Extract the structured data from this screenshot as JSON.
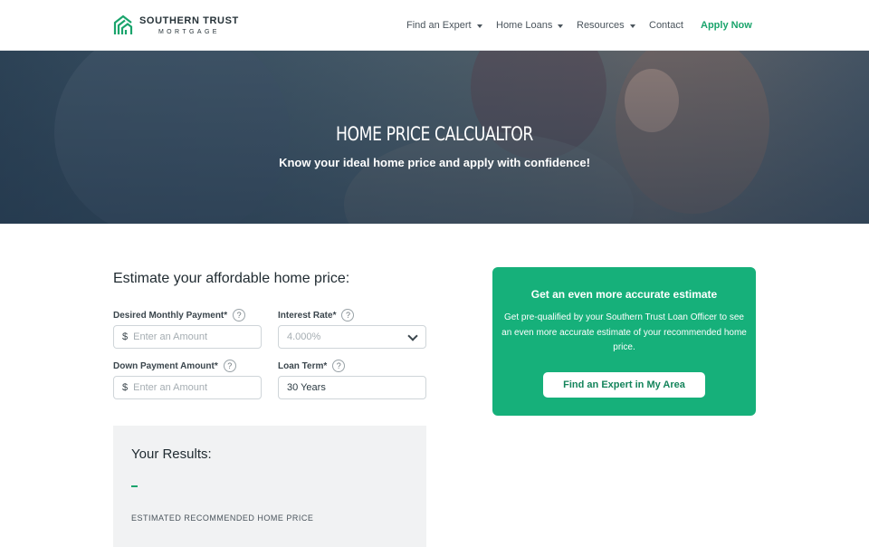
{
  "brand": {
    "name": "SOUTHERN TRUST",
    "sub": "MORTGAGE",
    "accent": "#1aa46c"
  },
  "nav": {
    "items": [
      {
        "label": "Find an Expert",
        "dropdown": true
      },
      {
        "label": "Home Loans",
        "dropdown": true
      },
      {
        "label": "Resources",
        "dropdown": true
      },
      {
        "label": "Contact",
        "dropdown": false
      }
    ],
    "apply_label": "Apply Now"
  },
  "hero": {
    "title": "HOME PRICE CALCUALTOR",
    "subtitle": "Know your ideal home price and apply with confidence!"
  },
  "calculator": {
    "title": "Estimate your affordable home price:",
    "monthly_payment": {
      "label": "Desired Monthly Payment*",
      "prefix": "$",
      "placeholder": "Enter an Amount",
      "value": ""
    },
    "interest_rate": {
      "label": "Interest Rate*",
      "selected": "4.000%"
    },
    "down_payment": {
      "label": "Down Payment Amount*",
      "prefix": "$",
      "placeholder": "Enter an Amount",
      "value": ""
    },
    "loan_term": {
      "label": "Loan Term*",
      "value": "30 Years"
    },
    "help_glyph": "?"
  },
  "results": {
    "title": "Your Results:",
    "value": "–",
    "caption": "ESTIMATED RECOMMENDED HOME PRICE"
  },
  "promo": {
    "title": "Get an even more accurate estimate",
    "text": "Get pre-qualified by your Southern Trust Loan Officer to see an even more accurate estimate of your recommended home price.",
    "button": "Find an Expert in My Area",
    "color": "#16b07a"
  }
}
